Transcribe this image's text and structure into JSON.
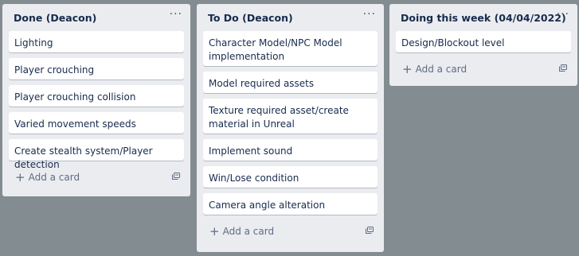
{
  "lists": [
    {
      "title": "Done (Deacon)",
      "menu": "···",
      "cards": [
        "Lighting",
        "Player crouching",
        "Player crouching collision",
        "Varied movement speeds",
        "Create stealth system/Player detection"
      ],
      "add_label": "Add a card"
    },
    {
      "title": "To Do (Deacon)",
      "menu": "···",
      "cards": [
        "Character Model/NPC Model implementation",
        "Model required assets",
        "Texture required asset/create material in Unreal",
        "Implement sound",
        "Win/Lose condition",
        "Camera angle alteration"
      ],
      "add_label": "Add a card"
    },
    {
      "title": "Doing this week (04/04/2022)",
      "menu": "···",
      "cards": [
        "Design/Blockout level"
      ],
      "add_label": "Add a card"
    }
  ],
  "icons": {
    "add": "+",
    "menu": "more-horizontal-icon",
    "template": "card-template-icon"
  },
  "colors": {
    "board_bg": "#838c91",
    "list_bg": "#ebecf0",
    "card_bg": "#ffffff",
    "text": "#172b4d",
    "muted": "#5e6c84"
  }
}
